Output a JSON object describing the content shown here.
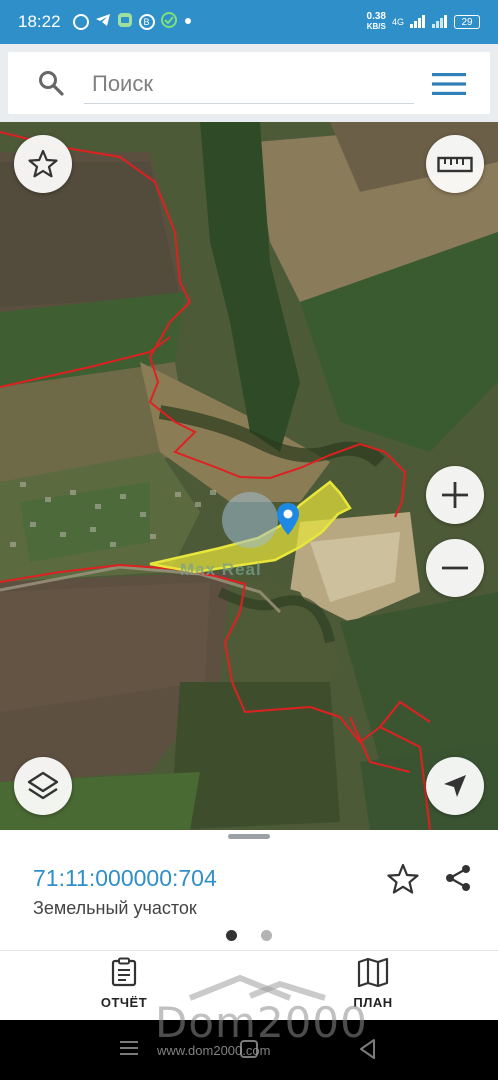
{
  "status_bar": {
    "time": "18:22",
    "net_speed_value": "0.38",
    "net_speed_unit": "KB/S",
    "network": "4G",
    "battery": "29",
    "app_icons": [
      "whatsapp-icon",
      "telegram-icon",
      "messenger-icon",
      "vk-icon",
      "check-icon",
      "dot-icon"
    ]
  },
  "search": {
    "placeholder": "Поиск"
  },
  "map": {
    "watermark": "Max Real",
    "parcel_highlight_color": "#e8e63a",
    "boundary_color": "#e02020",
    "controls": {
      "favorite": "star-icon",
      "ruler": "ruler-icon",
      "zoom_in": "plus-icon",
      "zoom_out": "minus-icon",
      "layers": "layers-icon",
      "locate": "navigation-arrow-icon"
    }
  },
  "info_panel": {
    "cadastral_number": "71:11:000000:704",
    "parcel_type": "Земельный участок",
    "accent_color": "#2f8fc8",
    "page_indicator": {
      "count": 2,
      "active": 1
    }
  },
  "tabs": [
    {
      "label": "ОТЧЁТ",
      "icon": "clipboard-icon"
    },
    {
      "label": "ПЛАН",
      "icon": "map-icon"
    }
  ],
  "site_watermark": {
    "big": "Dom2000",
    "small": "www.dom2000.com"
  }
}
